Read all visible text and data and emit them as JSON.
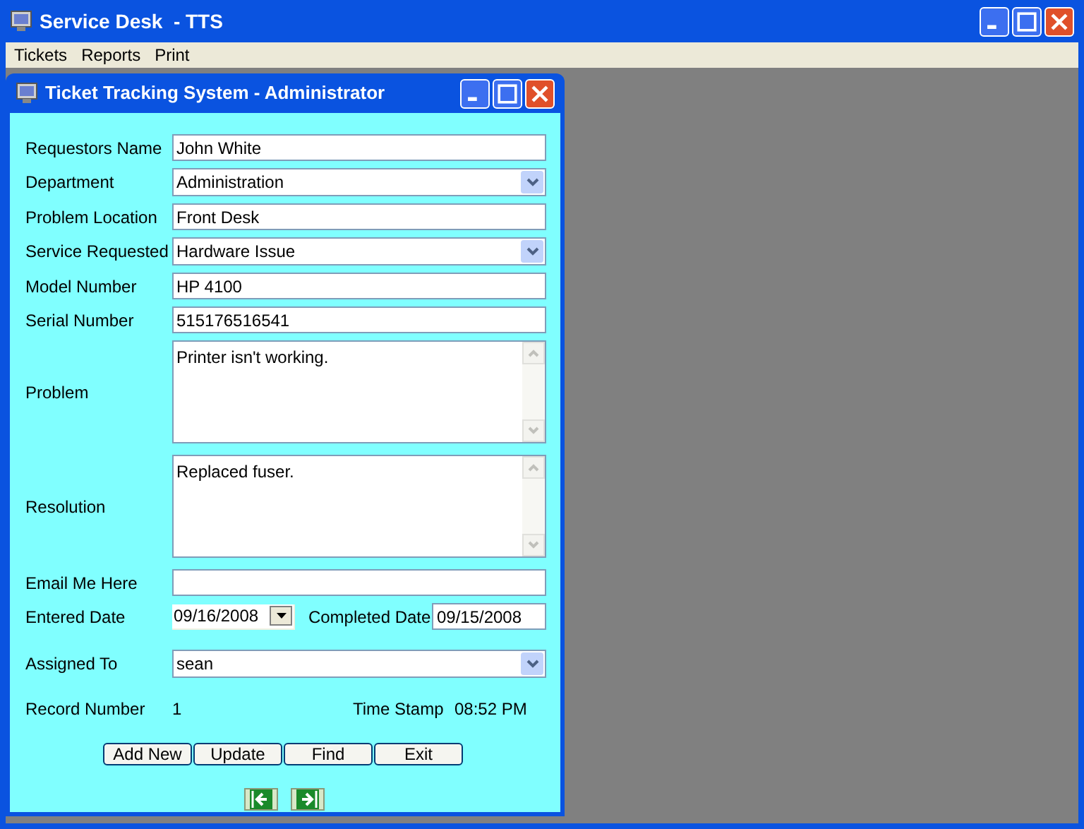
{
  "window": {
    "title": "Service Desk  - TTS"
  },
  "menu": [
    "Tickets",
    "Reports",
    "Print"
  ],
  "child_window": {
    "title": "Ticket Tracking System - Administrator"
  },
  "fields": [
    {
      "kind": "text",
      "label": "Requestors Name",
      "value": "John White"
    },
    {
      "kind": "combo",
      "label": "Department",
      "value": "Administration"
    },
    {
      "kind": "text",
      "label": "Problem Location",
      "value": "Front Desk"
    },
    {
      "kind": "combo",
      "label": "Service Requested",
      "value": "Hardware Issue"
    },
    {
      "kind": "text",
      "label": "Model Number",
      "value": "HP 4100"
    },
    {
      "kind": "text",
      "label": "Serial Number",
      "value": "515176516541"
    },
    {
      "kind": "memo",
      "label": "Problem",
      "value": "Printer isn't working."
    },
    {
      "kind": "memo",
      "label": "Resolution",
      "value": "Replaced fuser."
    },
    {
      "kind": "text",
      "label": "Email Me Here"
    }
  ],
  "dates": {
    "entered_label": "Entered Date",
    "entered": "09/16/2008",
    "completed_label": "Completed Date",
    "completed": "09/15/2008"
  },
  "assigned": {
    "label": "Assigned To",
    "value": "sean"
  },
  "record": {
    "label": "Record Number",
    "value": "1",
    "timestamp_label": "Time Stamp",
    "timestamp": "08:52 PM"
  },
  "buttons": [
    "Add New",
    "Update",
    "Find",
    "Exit"
  ]
}
